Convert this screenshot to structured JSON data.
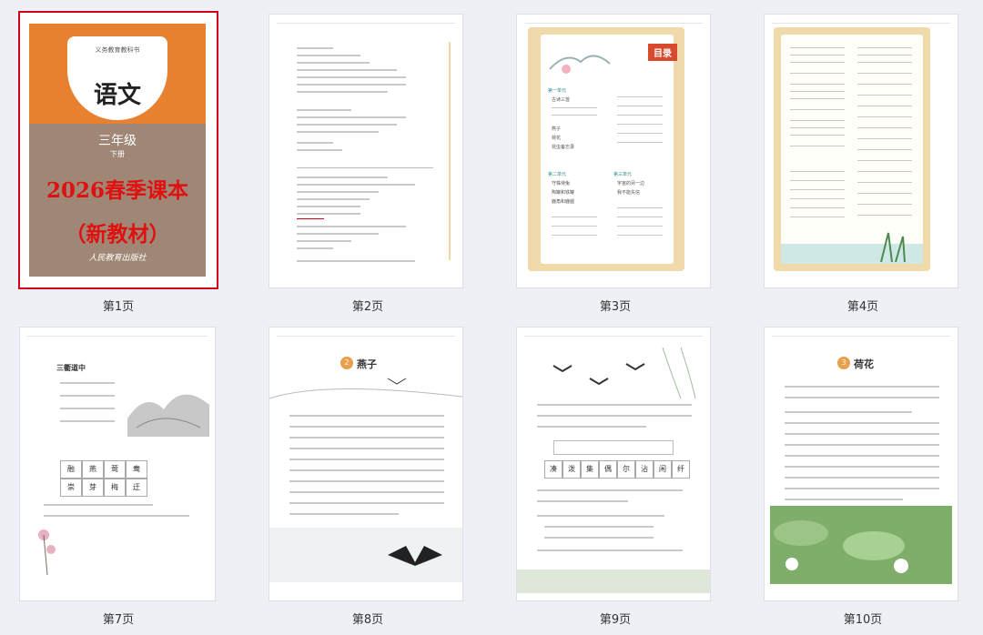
{
  "pages": [
    {
      "label": "第1页"
    },
    {
      "label": "第2页"
    },
    {
      "label": "第3页"
    },
    {
      "label": "第4页"
    },
    {
      "label": "第7页"
    },
    {
      "label": "第8页"
    },
    {
      "label": "第9页"
    },
    {
      "label": "第10页"
    }
  ],
  "cover": {
    "publisher_series": "义务教育教科书",
    "title": "语文",
    "grade": "三年级",
    "semester": "下册",
    "promo_line1": "2026春季课本",
    "promo_line2": "（新教材）",
    "press": "人民教育出版社"
  },
  "toc": {
    "tag": "目录",
    "units": [
      "第一单元",
      "第二单元",
      "第三单元"
    ],
    "lessons": [
      "古诗三首",
      "燕子",
      "荷花",
      "昆虫备忘录",
      "守株待兔",
      "陶罐和铁罐",
      "鹿角和鹿腿",
      "宇宙的另一边",
      "我不能失信"
    ]
  },
  "lessons": {
    "p7_unit_title": "三衢道中",
    "p7_words_a": [
      "融",
      "燕",
      "莺",
      "鸯"
    ],
    "p7_words_b": [
      "崇",
      "芽",
      "梅",
      "迂"
    ],
    "p8_lesson": "燕子",
    "p8_lesson_no": "2",
    "p9_words": [
      "凑",
      "泼",
      "集",
      "偶",
      "尔",
      "沾",
      "闲",
      "纤"
    ],
    "p10_lesson": "荷花",
    "p10_lesson_no": "3"
  },
  "colors": {
    "selected_border": "#d0021b",
    "cover_orange": "#e7812f",
    "promo_red": "#e01010"
  }
}
